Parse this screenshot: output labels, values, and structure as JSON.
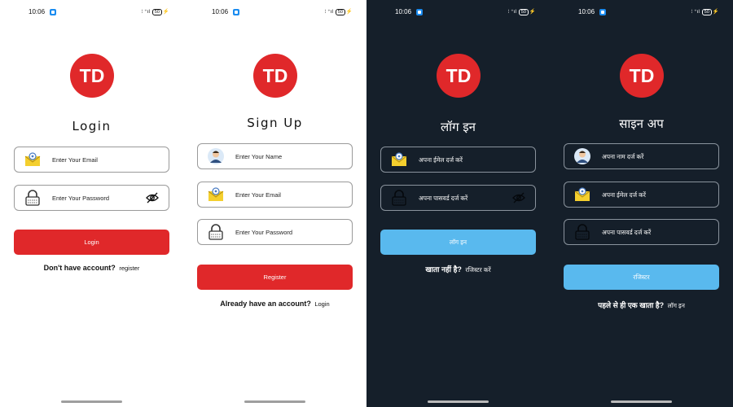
{
  "status": {
    "time": "10:06",
    "battery": "50"
  },
  "brand": {
    "logo_text": "TD",
    "logo_color": "#e0282a"
  },
  "screens": [
    {
      "title": "Login",
      "email_placeholder": "Enter Your Email",
      "password_placeholder": "Enter Your Password",
      "button": "Login",
      "footer_question": "Don't have account?",
      "footer_link": "register"
    },
    {
      "title": "Sign Up",
      "name_placeholder": "Enter Your Name",
      "email_placeholder": "Enter Your Email",
      "password_placeholder": "Enter Your Password",
      "button": "Register",
      "footer_question": "Already have an account?",
      "footer_link": "Login"
    },
    {
      "title": "लॉग इन",
      "email_placeholder": "अपना ईमेल दर्ज करें",
      "password_placeholder": "अपना पासवर्ड दर्ज करें",
      "button": "लॉग इन",
      "footer_question": "खाता नहीं है?",
      "footer_link": "रजिस्टर करें"
    },
    {
      "title": "साइन अप",
      "name_placeholder": "अपना नाम दर्ज करें",
      "email_placeholder": "अपना ईमेल दर्ज करें",
      "password_placeholder": "अपना पासवर्ड दर्ज करें",
      "button": "रजिस्टर",
      "footer_question": "पहले से ही एक खाता है?",
      "footer_link": "लॉग इन"
    }
  ],
  "colors": {
    "primary_red": "#e0282a",
    "accent_blue": "#59b9ee",
    "dark_bg": "#151f2a"
  },
  "icons": [
    "email-icon",
    "lock-icon",
    "user-icon",
    "eye-off-icon",
    "notification-icon"
  ]
}
